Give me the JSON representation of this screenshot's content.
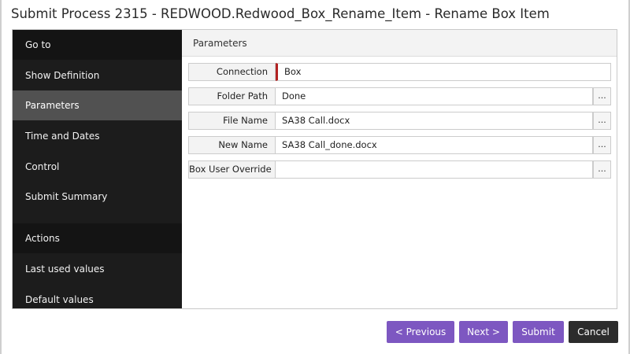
{
  "dialog": {
    "title": "Submit Process 2315 - REDWOOD.Redwood_Box_Rename_Item - Rename Box Item"
  },
  "sidebar": {
    "items": [
      {
        "label": "Go to"
      },
      {
        "label": "Show Definition"
      },
      {
        "label": "Parameters"
      },
      {
        "label": "Time and Dates"
      },
      {
        "label": "Control"
      },
      {
        "label": "Submit Summary"
      }
    ],
    "secondary_items": [
      {
        "label": "Actions"
      },
      {
        "label": "Last used values"
      },
      {
        "label": "Default values"
      }
    ]
  },
  "parameters": {
    "header": "Parameters",
    "fields": [
      {
        "label": "Connection",
        "value": "Box"
      },
      {
        "label": "Folder Path",
        "value": "Done"
      },
      {
        "label": "File Name",
        "value": "SA38 Call.docx"
      },
      {
        "label": "New Name",
        "value": "SA38 Call_done.docx"
      },
      {
        "label": "Box User Override",
        "value": ""
      }
    ],
    "lookup_label": "..."
  },
  "footer": {
    "previous_label": "< Previous",
    "next_label": "Next >",
    "submit_label": "Submit",
    "cancel_label": "Cancel"
  },
  "colors": {
    "accent": "#7d57c1",
    "sidebar_bg": "#1c1c1c",
    "sidebar_active": "#515151",
    "required_marker": "#b22222",
    "cancel_bg": "#2c2c2c"
  }
}
